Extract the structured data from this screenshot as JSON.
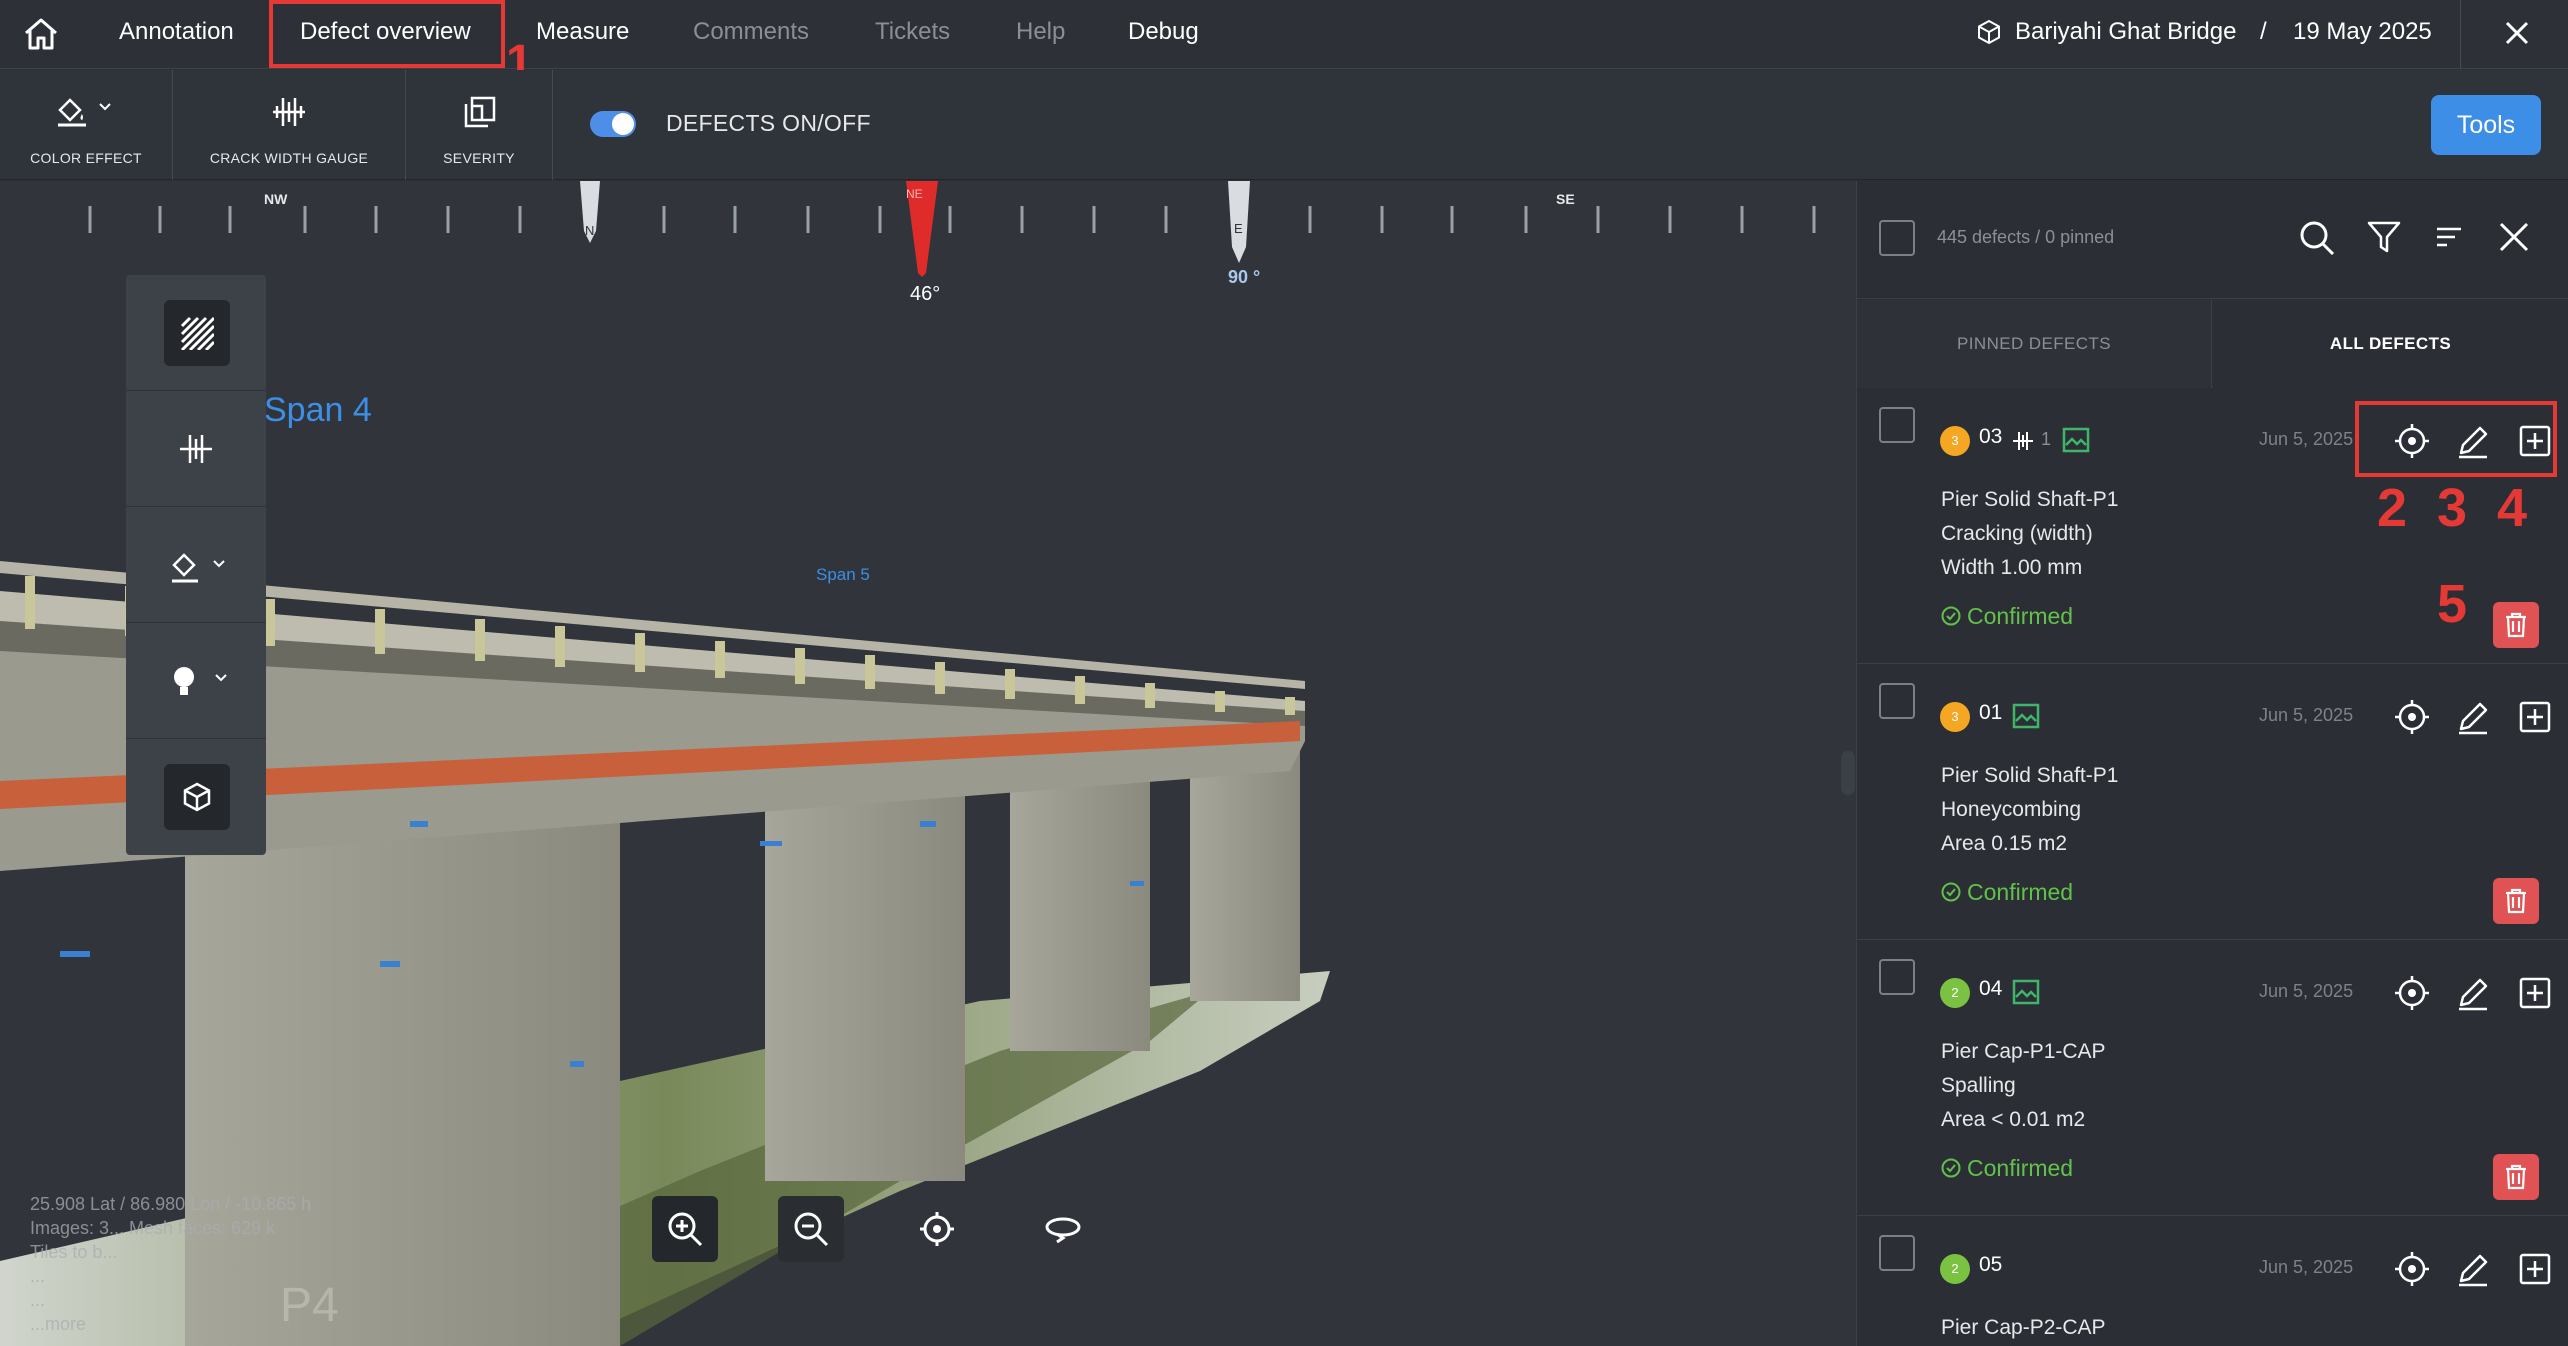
{
  "nav": {
    "items": [
      "Annotation",
      "Defect overview",
      "Measure",
      "Comments",
      "Tickets",
      "Help",
      "Debug"
    ],
    "project": "Bariyahi Ghat Bridge",
    "separator": "/",
    "date": "19 May 2025",
    "close_icon": "close-icon"
  },
  "toolbar": {
    "color_effect": "COLOR EFFECT",
    "crack_width_gauge": "CRACK WIDTH GAUGE",
    "severity": "SEVERITY",
    "defects_toggle": "DEFECTS ON/OFF",
    "defects_on": true,
    "tools": "Tools"
  },
  "compass": {
    "labels": [
      "NW",
      "N",
      "NE",
      "E",
      "SE"
    ],
    "heading": "46°",
    "east_reading": "90 °"
  },
  "viewport": {
    "span4": "Span 4",
    "span5": "Span 5",
    "pier_label": "P4",
    "coords": [
      "25.908 Lat / 86.980 Lon / -10.865 h",
      "Images: 3... Mesh faces: 629 k",
      "Tiles to b...",
      "...",
      "...",
      "...more"
    ]
  },
  "panel": {
    "count": "445 defects / 0 pinned",
    "tabs": [
      "PINNED DEFECTS",
      "ALL DEFECTS"
    ],
    "cards": [
      {
        "severity": "3",
        "id": "03",
        "crack_count": "1",
        "date": "Jun 5, 2025",
        "location": "Pier Solid Shaft-P1",
        "type": "Cracking (width)",
        "measure": "Width 1.00 mm",
        "status": "Confirmed"
      },
      {
        "severity": "3",
        "id": "01",
        "date": "Jun 5, 2025",
        "location": "Pier Solid Shaft-P1",
        "type": "Honeycombing",
        "measure": "Area 0.15 m2",
        "status": "Confirmed"
      },
      {
        "severity": "2",
        "id": "04",
        "date": "Jun 5, 2025",
        "location": "Pier Cap-P1-CAP",
        "type": "Spalling",
        "measure": "Area < 0.01 m2",
        "status": "Confirmed"
      },
      {
        "severity": "2",
        "id": "05",
        "date": "Jun 5, 2025",
        "location": "Pier Cap-P2-CAP"
      }
    ]
  },
  "annotations": {
    "n1": "1",
    "n2": "2",
    "n3": "3",
    "n4": "4",
    "n5": "5"
  },
  "colors": {
    "accent": "#3d8ee6",
    "highlight": "#e53935",
    "confirmed": "#62c14b",
    "severity3": "#f5a623",
    "severity2": "#7cc242",
    "delete": "#e05254"
  }
}
